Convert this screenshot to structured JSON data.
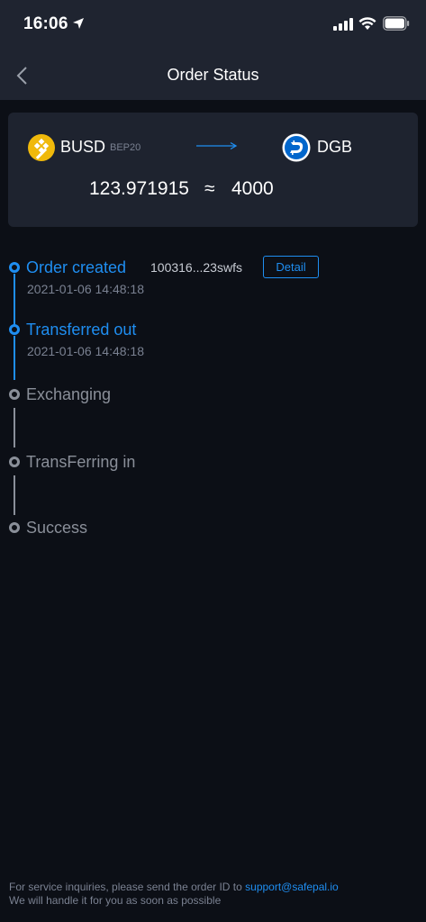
{
  "status_bar": {
    "time": "16:06"
  },
  "header": {
    "title": "Order Status"
  },
  "swap": {
    "from_symbol": "BUSD",
    "from_network": "BEP20",
    "to_symbol": "DGB",
    "from_amount": "123.971915",
    "approx": "≈",
    "to_amount": "4000"
  },
  "steps": [
    {
      "label": "Order created",
      "time": "2021-01-06 14:48:18",
      "order_id": "100316...23swfs",
      "detail_label": "Detail",
      "active": true
    },
    {
      "label": "Transferred out",
      "time": "2021-01-06 14:48:18",
      "active": true
    },
    {
      "label": "Exchanging",
      "active": false
    },
    {
      "label": "TransFerring in",
      "active": false
    },
    {
      "label": "Success",
      "active": false
    }
  ],
  "footer": {
    "line1": "For service inquiries, please send the order ID to",
    "email": "support@safepal.io",
    "line2": "We will handle it for you as soon as possible"
  },
  "colors": {
    "accent": "#1f8ef1",
    "inactive": "#8a8f99",
    "background": "#0c0f16",
    "header_background": "#1f2430",
    "card_background": "#1e232f",
    "busd_brand": "#f0b90b",
    "dgb_brand": "#0066cc"
  }
}
